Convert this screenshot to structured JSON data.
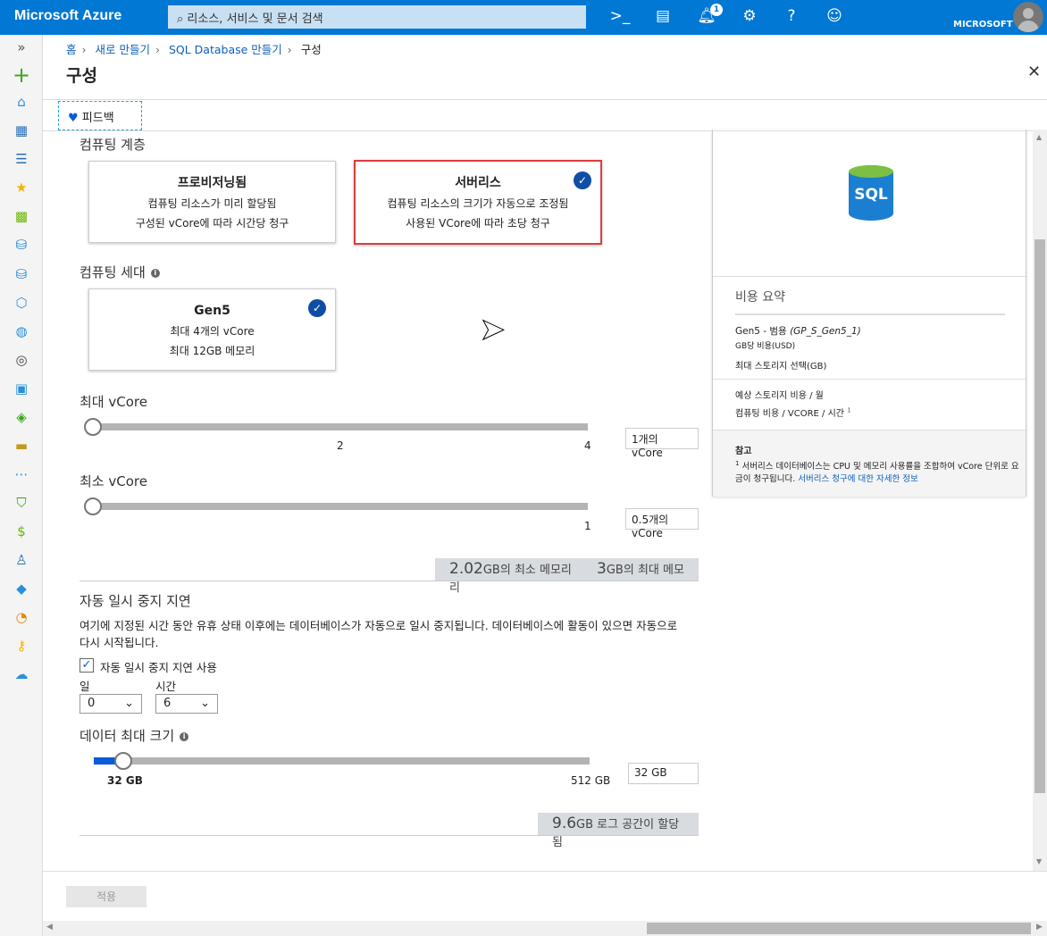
{
  "header": {
    "brand": "Microsoft Azure",
    "search_placeholder": "리소스, 서비스 및 문서 검색",
    "notification_count": "1",
    "account": "MICROSOFT"
  },
  "breadcrumb": [
    "홈",
    "새로 만들기",
    "SQL Database 만들기",
    "구성"
  ],
  "page_title": "구성",
  "feedback_label": "피드백",
  "compute_tier": {
    "label": "컴퓨팅 계층",
    "cards": [
      {
        "title": "프로비저닝됨",
        "line1": "컴퓨팅 리소스가 미리 할당됨",
        "line2": "구성된 vCore에 따라 시간당 청구",
        "selected": false
      },
      {
        "title": "서버리스",
        "line1": "컴퓨팅 리소스의 크기가 자동으로 조정됨",
        "line2": "사용된 VCore에 따라 초당 청구",
        "selected": true
      }
    ]
  },
  "compute_gen": {
    "label": "컴퓨팅 세대",
    "card": {
      "title": "Gen5",
      "line1": "최대 4개의 vCore",
      "line2": "최대 12GB 메모리",
      "selected": true
    }
  },
  "max_vcore": {
    "label": "최대 vCore",
    "ticks": [
      "2",
      "4"
    ],
    "value": "1개의 vCore"
  },
  "min_vcore": {
    "label": "최소 vCore",
    "ticks": [
      "1"
    ],
    "value": "0.5개의 vCore"
  },
  "memory": {
    "min_value": "2.02",
    "min_label": "GB의 최소 메모리",
    "max_value": "3",
    "max_label": "GB의 최대 메모리"
  },
  "autopause": {
    "label": "자동 일시 중지 지연",
    "description": "여기에 지정된 시간 동안 유휴 상태 이후에는 데이터베이스가 자동으로 일시 중지됩니다. 데이터베이스에 활동이 있으면 자동으로 다시 시작됩니다.",
    "checkbox_label": "자동 일시 중지 지연 사용",
    "checked": true,
    "day_label": "일",
    "day_value": "0",
    "hour_label": "시간",
    "hour_value": "6"
  },
  "data_size": {
    "label": "데이터 최대 크기",
    "min_tick": "32 GB",
    "max_tick": "512 GB",
    "value": "32 GB",
    "fill_fraction": 0.06
  },
  "log": {
    "value": "9.6",
    "label": "GB 로그 공간이 할당됨"
  },
  "apply_label": "적용",
  "summary": {
    "logo_text": "SQL",
    "title": "비용 요약",
    "tier": "Gen5 - 범용",
    "tier_code": "(GP_S_Gen5_1)",
    "per_gb": "GB당 비용(USD)",
    "max_storage": "최대 스토리지 선택(GB)",
    "storage_cost": "예상 스토리지 비용 / 월",
    "compute_cost": "컴퓨팅 비용 / VCORE / 시간",
    "footnote_mark": "1",
    "note_title": "참고",
    "note_text": "서버리스 데이터베이스는 CPU 및 메모리 사용률을 조합하여 vCore 단위로 요금이 청구됩니다.",
    "note_link": "서버리스 청구에 대한 자세한 정보"
  },
  "colors": {
    "brand": "#0078d4",
    "accent": "#0f4ea6",
    "selected_border": "#e03c3c"
  }
}
